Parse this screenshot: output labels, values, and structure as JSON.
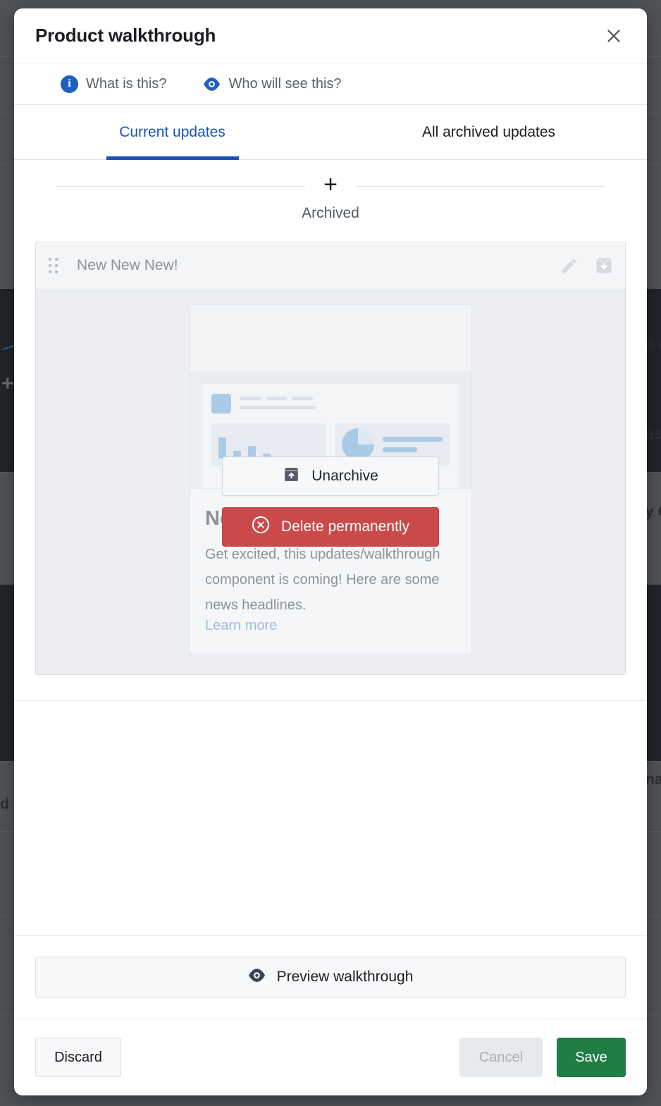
{
  "modal": {
    "title": "Product walkthrough",
    "close_icon": "close-icon",
    "helpers": [
      {
        "icon": "info-icon",
        "label": "What is this?"
      },
      {
        "icon": "eye-icon",
        "label": "Who will see this?"
      }
    ],
    "tabs": [
      {
        "label": "Current updates",
        "active": true
      },
      {
        "label": "All archived updates",
        "active": false
      }
    ],
    "archived_divider": {
      "plus": "+",
      "label": "Archived"
    },
    "item": {
      "title": "New New New!",
      "drag_handle_icon": "drag-handle-icon",
      "edit_icon": "pencil-icon",
      "archive_icon": "archive-down-icon"
    },
    "overlay_actions": {
      "unarchive": {
        "label": "Unarchive",
        "icon": "unarchive-icon"
      },
      "delete": {
        "label": "Delete permanently",
        "icon": "delete-circle-icon"
      }
    },
    "preview_content": {
      "heading": "New New New!",
      "body": "Get excited, this updates/walkthrough component is coming! Here are some news headlines.",
      "link": "Learn more"
    },
    "preview_walkthrough": {
      "label": "Preview walkthrough",
      "icon": "eye-icon"
    },
    "footer": {
      "discard": "Discard",
      "cancel": "Cancel",
      "save": "Save"
    }
  },
  "colors": {
    "accent_blue": "#1a54b8",
    "danger_red": "#ca4a4a",
    "success_green": "#1f7d46",
    "muted_text": "#8d939b",
    "link_blue": "#9dbde0"
  },
  "background": {
    "obscured_text": [
      "d",
      "n A",
      "as",
      "y C",
      "na"
    ]
  }
}
